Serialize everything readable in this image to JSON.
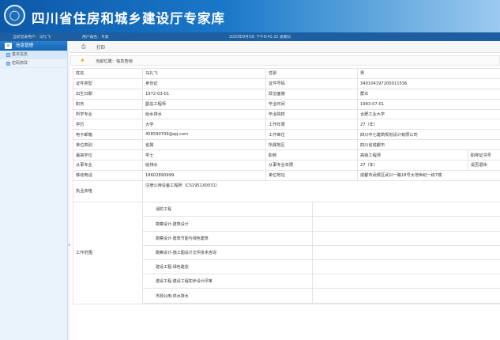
{
  "header": {
    "logo_glyph": "◯",
    "title": "四川省住房和城乡建设厅专家库"
  },
  "status": {
    "user": "当前登录用户：马礼飞",
    "role": "用户角色：专家",
    "datetime": "2020年9月5日 下午8:41:32 星期日"
  },
  "sidebar": {
    "section": "信息管理",
    "items": [
      {
        "label": "基本信息"
      },
      {
        "label": "密码修改"
      }
    ]
  },
  "toolbar": {
    "print_icon": "⎙",
    "print_label": "打印"
  },
  "location": {
    "icon": "✦",
    "text": "当前位置：信息查询"
  },
  "form": {
    "name_label": "姓名",
    "name": "马礼飞",
    "gender_label": "性别",
    "gender": "男",
    "id_type_label": "证件类型",
    "id_type": "身份证",
    "id_no_label": "证件号码",
    "id_no": "340104197200011536",
    "birth_label": "出生日期",
    "birth": "1972-03-01",
    "politics_label": "政治面貌",
    "politics": "群众",
    "title_label": "职务",
    "title": "副总工程师",
    "grad_time_label": "毕业时间",
    "grad_time": "1993-07-01",
    "major_label": "所学专业",
    "major": "给水排水",
    "school_label": "毕业院校",
    "school": "合肥工业大学",
    "edu_label": "学历",
    "edu": "大学",
    "years_label": "工作年限",
    "years": "27（年）",
    "email_label": "电子邮箱",
    "email": "458590709@qq.com",
    "employer_label": "工作单位",
    "employer": "四川中七建筑规划设计有限公司",
    "unit_type_label": "单位类别",
    "unit_type": "省属",
    "region_label": "所属地区",
    "region": "四川省成都市",
    "degree_label": "最高学位",
    "degree": "学士",
    "rank_label": "职称",
    "rank": "高级工程师",
    "cert_label": "职称证书号",
    "field_label": "从事专业",
    "field": "给排水",
    "field_years_label": "从事专业年限",
    "field_years": "27（年）",
    "retired_label": "是否退休",
    "mobile_label": "移动电话",
    "mobile": "18602890999",
    "address_label": "单位地址",
    "address": "成都市武侯区武兴一路18号大地世纪一栋7楼",
    "qual_label": "执业资格",
    "qual": "注册公用设备工程师（CS1951X0031）",
    "scope_label": "工作范围",
    "scope": [
      "消防工程",
      "勘察设计-建筑设计",
      "勘察设计-建筑节能与绿色建筑",
      "勘察设计-施工图设计文件技术咨询",
      "建设工程-绿色建造",
      "建设工程-建设工程初步设计评审",
      "市政公用-供水排水"
    ]
  }
}
